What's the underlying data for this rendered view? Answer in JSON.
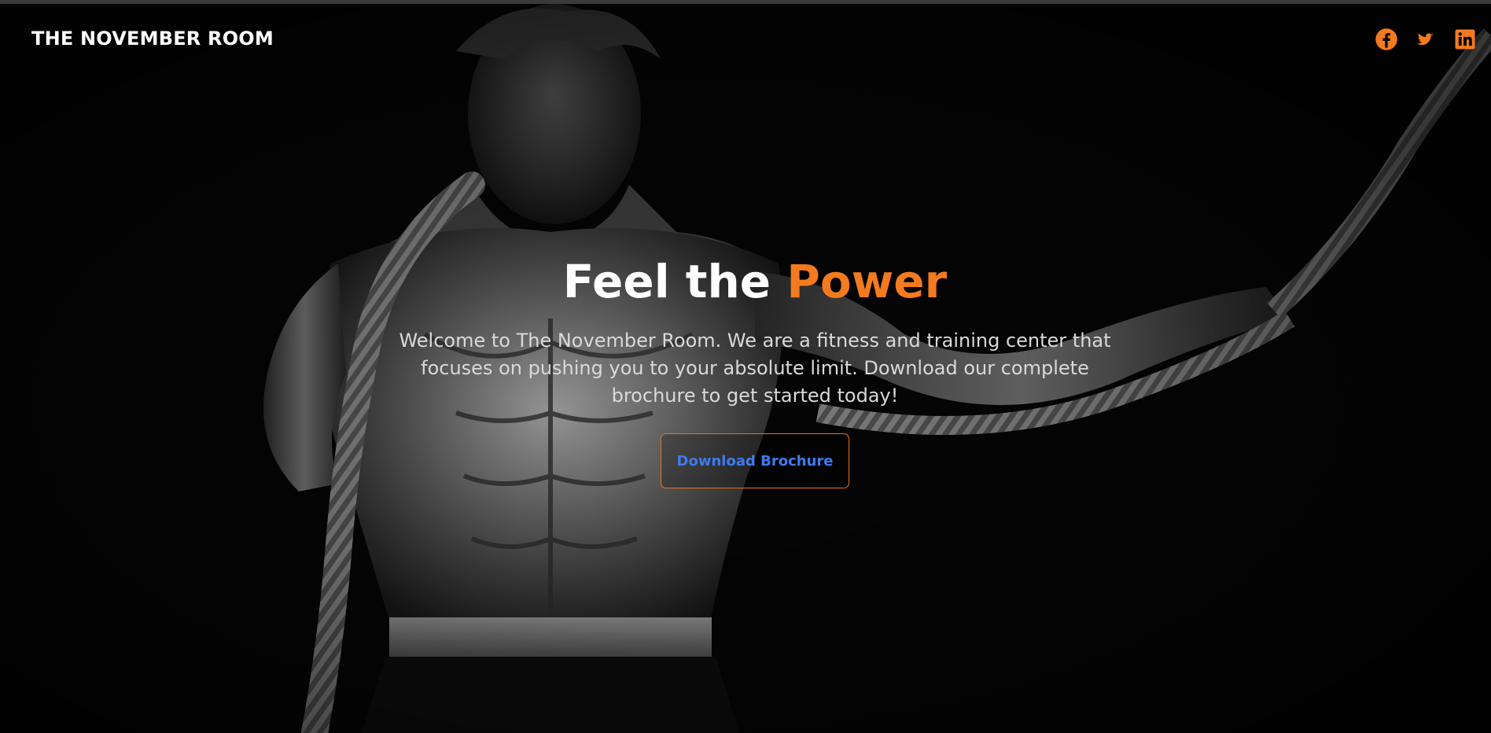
{
  "brand": {
    "name": "THE NOVEMBER ROOM"
  },
  "socials": [
    {
      "name": "facebook-icon"
    },
    {
      "name": "twitter-icon"
    },
    {
      "name": "linkedin-icon"
    }
  ],
  "hero": {
    "headline_start": "Feel the",
    "headline_accent": "Power",
    "intro": "Welcome to The November Room. We are a fitness and training center that focuses on pushing you to your absolute limit. Download our complete brochure to get started today!",
    "cta_label": "Download Brochure"
  },
  "colors": {
    "accent": "#f47a1f",
    "link": "#3d7bf0",
    "background": "#050505"
  }
}
